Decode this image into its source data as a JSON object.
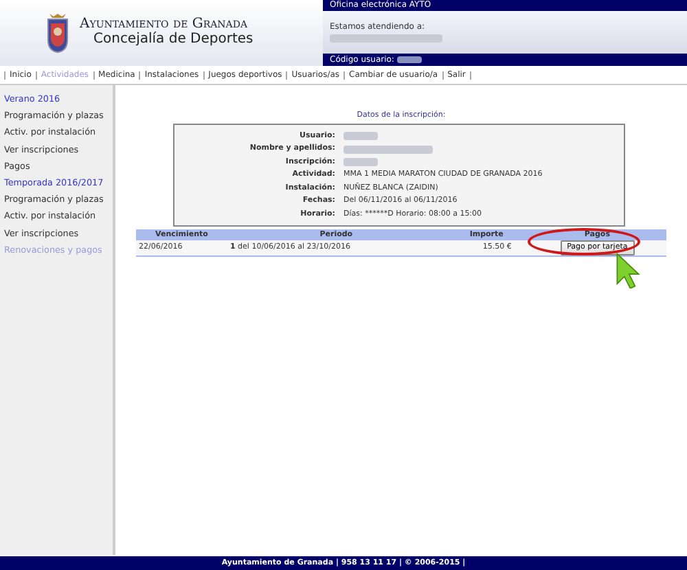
{
  "header": {
    "org_line1": "Ayuntamiento de Granada",
    "org_line2": "Concejalía de Deportes",
    "office_title": "Oficina electrónica AYTO",
    "attending_label": "Estamos atendiendo a:",
    "user_code_label": "Código usuario:"
  },
  "nav": [
    {
      "label": "Inicio",
      "selected": false
    },
    {
      "label": "Actividades",
      "selected": true
    },
    {
      "label": "Medicina",
      "selected": false
    },
    {
      "label": "Instalaciones",
      "selected": false
    },
    {
      "label": "Juegos deportivos",
      "selected": false
    },
    {
      "label": "Usuarios/as",
      "selected": false
    },
    {
      "label": "Cambiar de usuario/a",
      "selected": false
    },
    {
      "label": "Salir",
      "selected": false
    }
  ],
  "sidebar": {
    "items": [
      {
        "label": "Verano 2016",
        "kind": "heading"
      },
      {
        "label": "Programación y plazas",
        "kind": "link"
      },
      {
        "label": "Activ. por instalación",
        "kind": "link"
      },
      {
        "label": "Ver inscripciones",
        "kind": "link"
      },
      {
        "label": "Pagos",
        "kind": "link"
      },
      {
        "label": "Temporada 2016/2017",
        "kind": "heading"
      },
      {
        "label": "Programación y plazas",
        "kind": "link"
      },
      {
        "label": "Activ. por instalación",
        "kind": "link"
      },
      {
        "label": "Ver inscripciones",
        "kind": "link"
      },
      {
        "label": "Renovaciones y pagos",
        "kind": "visited"
      }
    ]
  },
  "registration": {
    "title": "Datos de la inscripción:",
    "fields": [
      {
        "label": "Usuario:"
      },
      {
        "label": "Nombre y apellidos:"
      },
      {
        "label": "Inscripción:"
      },
      {
        "label": "Actividad:",
        "value": "MMA 1 MEDIA MARATON CIUDAD DE GRANADA 2016"
      },
      {
        "label": "Instalación:",
        "value": "NUÑEZ BLANCA (ZAIDIN)"
      },
      {
        "label": "Fechas:",
        "value": "Del 06/11/2016 al 06/11/2016"
      },
      {
        "label": "Horario:",
        "value": "Días: ******D Horario: 08:00 a 15:00"
      }
    ]
  },
  "payments": {
    "columns": [
      "Vencimiento",
      "Periodo",
      "Importe",
      "Pagos"
    ],
    "rows": [
      {
        "due": "22/06/2016",
        "period_number": "1",
        "period": "del 10/06/2016 al 23/10/2016",
        "amount": "15.50 €",
        "button": "Pago por tarjeta"
      }
    ]
  },
  "footer": "Ayuntamiento de Granada | 958 13 11 17 | © 2006-2015 |"
}
